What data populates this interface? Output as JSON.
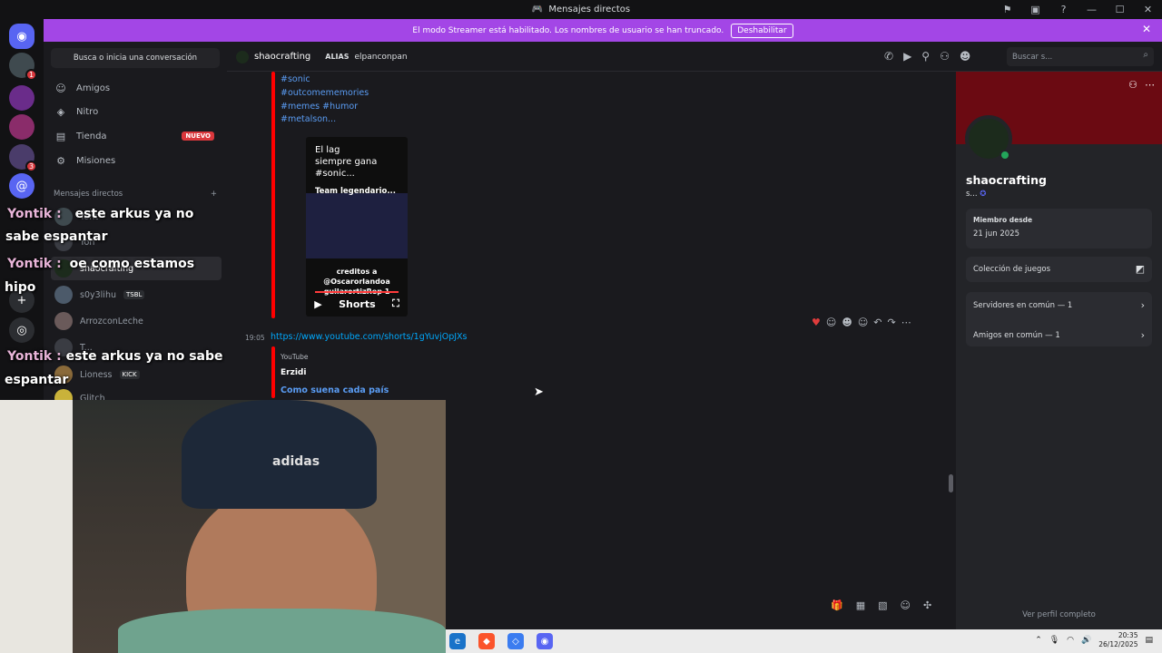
{
  "window": {
    "title": "Mensajes directos"
  },
  "banner": {
    "text": "El modo Streamer está habilitado. Los nombres de usuario se han truncado.",
    "button": "Deshabilitar"
  },
  "sidebar": {
    "search": "Busca o inicia una conversación",
    "nav": [
      {
        "label": "Amigos",
        "icon": "friends-icon"
      },
      {
        "label": "Nitro",
        "icon": "nitro-icon"
      },
      {
        "label": "Tienda",
        "icon": "shop-icon",
        "badge": "NUEVO"
      },
      {
        "label": "Misiones",
        "icon": "quests-icon"
      }
    ],
    "dm_header": "Mensajes directos",
    "dms": [
      {
        "name": "Yont",
        "active": false
      },
      {
        "name": "Yon",
        "active": false
      },
      {
        "name": "shaocrafting",
        "active": true
      },
      {
        "name": "s0y3lihu",
        "tag": "TSBL",
        "active": false
      },
      {
        "name": "ArrozconLeche",
        "active": false
      },
      {
        "name": "T...",
        "active": false
      },
      {
        "name": "Lioness",
        "tag": "KICK",
        "active": false
      },
      {
        "name": "Glitch",
        "active": false
      }
    ]
  },
  "chat_header": {
    "username": "shaocrafting",
    "alias_label": "ALIAS",
    "alias_value": "elpanconpan",
    "search_placeholder": "Buscar s..."
  },
  "messages": {
    "hashtags": [
      "#sonic",
      "#outcomememories",
      "#memes #humor",
      "#metalson..."
    ],
    "video": {
      "top_text_1": "El lag",
      "top_text_2": "siempre gana",
      "top_text_3": "#sonic...",
      "channel": "Team legendario...",
      "credits_1": "creditos a",
      "credits_2": "@Oscarorlandoa",
      "credits_3": "guilarortizRep 1",
      "shorts": "Shorts"
    },
    "time": "19:05",
    "link": "https://www.youtube.com/shorts/1gYuvjOpJXs",
    "embed_source": "YouTube",
    "embed_author": "Erzidi",
    "embed_title": "Como suena cada país"
  },
  "profile": {
    "name": "shaocrafting",
    "status": "s...",
    "member_since_label": "Miembro desde",
    "member_since": "21 jun 2025",
    "games": "Colección de juegos",
    "servers_common": "Servidores en común — 1",
    "friends_common": "Amigos en común — 1",
    "full_profile": "Ver perfil completo"
  },
  "overlay": {
    "lines": [
      {
        "user": "Yontik :",
        "text": "este arkus ya no"
      },
      {
        "user": "",
        "text": "sabe espantar"
      },
      {
        "user": "Yontik :",
        "text": "oe como estamos"
      },
      {
        "user": "",
        "text": "hipo"
      },
      {
        "user": "Yontik :",
        "text": "este arkus ya no sabe"
      },
      {
        "user": "",
        "text": "espantar"
      }
    ]
  },
  "webcam": {
    "beanie_text": "adidas"
  },
  "taskbar": {
    "time": "20:35",
    "date": "26/12/2025"
  },
  "colors": {
    "banner": "#a346e6",
    "accent": "#5865f2",
    "online": "#23a55a",
    "youtube": "#ff0000",
    "link": "#00a8fc"
  }
}
